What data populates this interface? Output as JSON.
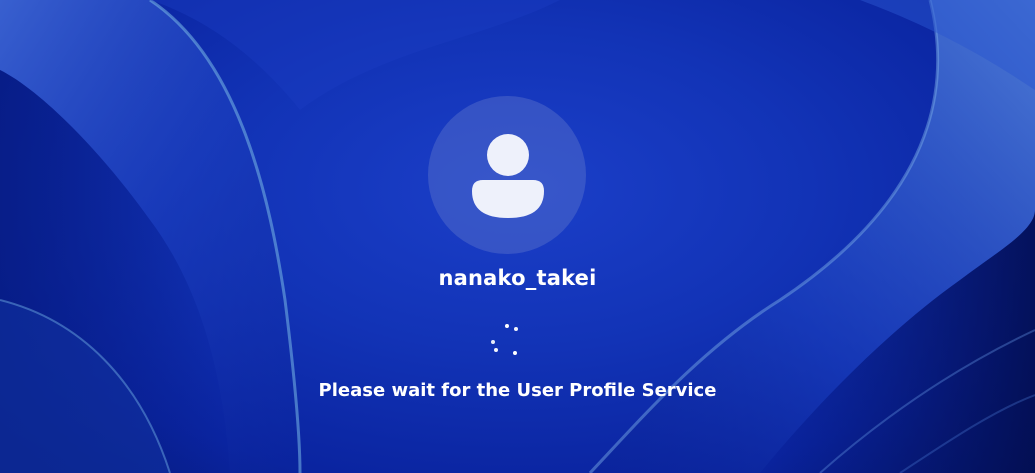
{
  "login": {
    "username": "nanako_takei",
    "status_message": "Please wait for the User Profile Service",
    "avatar_icon": "user-avatar-icon",
    "spinner_icon": "loading-spinner-icon"
  },
  "colors": {
    "background": "#0b2aa8",
    "ribbon_light": "#4f7bd8",
    "text": "#ffffff"
  }
}
